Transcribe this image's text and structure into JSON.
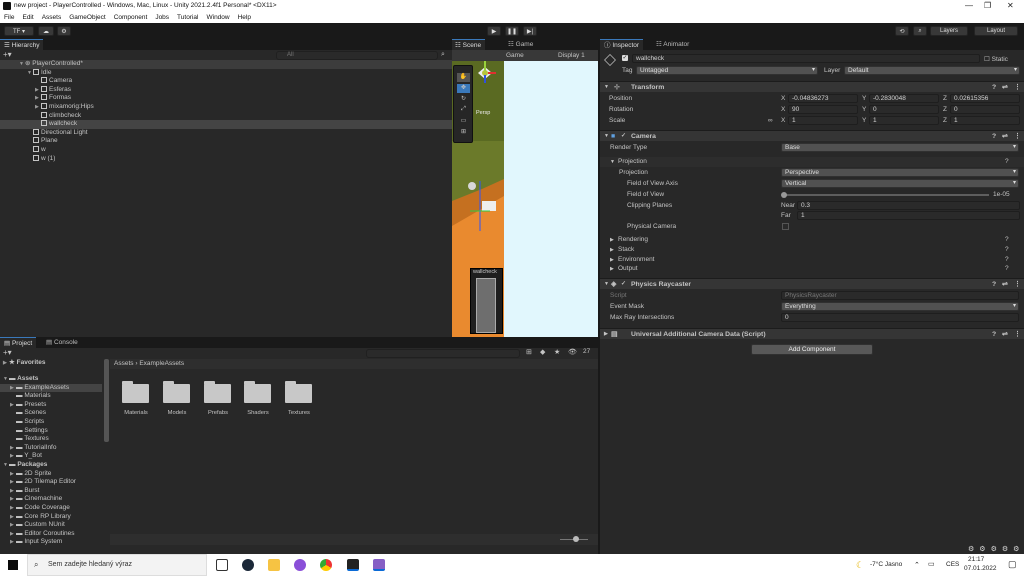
{
  "window": {
    "title": "new project - PlayerControlled - Windows, Mac, Linux - Unity 2021.2.4f1 Personal* <DX11>"
  },
  "menu": [
    "File",
    "Edit",
    "Assets",
    "GameObject",
    "Component",
    "Jobs",
    "Tutorial",
    "Window",
    "Help"
  ],
  "toolbar": {
    "account": "TF ▾",
    "layers": "Layers",
    "layout": "Layout"
  },
  "hierarchy": {
    "tab": "Hierarchy",
    "search_placeholder": "All",
    "scene": "PlayerControlled*",
    "items": [
      "Idle",
      "Camera",
      "Esferas",
      "Formas",
      "mixamorig:Hips",
      "climbcheck",
      "wallcheck",
      "Directional Light",
      "Plane",
      "w",
      "w (1)"
    ]
  },
  "scene": {
    "tab": "Scene",
    "persp": "Persp",
    "overlay_label": "wallcheck"
  },
  "game": {
    "tab": "Game",
    "sub_tab": "Game",
    "display": "Display 1"
  },
  "inspector": {
    "tab": "Inspector",
    "tab2": "Animator",
    "object_name": "wallcheck",
    "static_label": "Static",
    "tag_label": "Tag",
    "tag_value": "Untagged",
    "layer_label": "Layer",
    "layer_value": "Default",
    "transform": {
      "title": "Transform",
      "position_label": "Position",
      "rotation_label": "Rotation",
      "scale_label": "Scale",
      "position": {
        "x": "-0.04836273",
        "y": "-0.2830048",
        "z": "0.02615356"
      },
      "rotation": {
        "x": "90",
        "y": "0",
        "z": "0"
      },
      "scale": {
        "x": "1",
        "y": "1",
        "z": "1"
      }
    },
    "camera": {
      "title": "Camera",
      "render_type_label": "Render Type",
      "render_type": "Base",
      "projection_section": "Projection",
      "projection_label": "Projection",
      "projection": "Perspective",
      "fov_axis_label": "Field of View Axis",
      "fov_axis": "Vertical",
      "fov_label": "Field of View",
      "fov_value": "1e-05",
      "clipping_label": "Clipping Planes",
      "near_label": "Near",
      "near": "0.3",
      "far_label": "Far",
      "far": "1",
      "physical_label": "Physical Camera",
      "sections": [
        "Rendering",
        "Stack",
        "Environment",
        "Output"
      ]
    },
    "raycaster": {
      "title": "Physics Raycaster",
      "script_label": "Script",
      "script_value": "PhysicsRaycaster",
      "mask_label": "Event Mask",
      "mask_value": "Everything",
      "max_label": "Max Ray Intersections",
      "max_value": "0"
    },
    "urp": {
      "title": "Universal Additional Camera Data (Script)"
    },
    "add_component": "Add Component"
  },
  "project": {
    "tab": "Project",
    "tab2": "Console",
    "favorites": "Favorites",
    "assets": "Assets",
    "asset_items": [
      "ExampleAssets",
      "Materials",
      "Presets",
      "Scenes",
      "Scripts",
      "Settings",
      "Textures",
      "TutorialInfo",
      "Y_Bot"
    ],
    "packages": "Packages",
    "package_items": [
      "2D Sprite",
      "2D Tilemap Editor",
      "Burst",
      "Cinemachine",
      "Code Coverage",
      "Core RP Library",
      "Custom NUnit",
      "Editor Coroutines",
      "Input System"
    ],
    "breadcrumb_root": "Assets",
    "breadcrumb_sep": "›",
    "breadcrumb_current": "ExampleAssets",
    "folders": [
      "Materials",
      "Models",
      "Prefabs",
      "Shaders",
      "Textures"
    ],
    "count": "27"
  },
  "taskbar": {
    "search_placeholder": "Sem zadejte hledaný výraz",
    "weather": "-7°C  Jasno",
    "lang": "CES",
    "time": "21:17",
    "date": "07.01.2022"
  }
}
